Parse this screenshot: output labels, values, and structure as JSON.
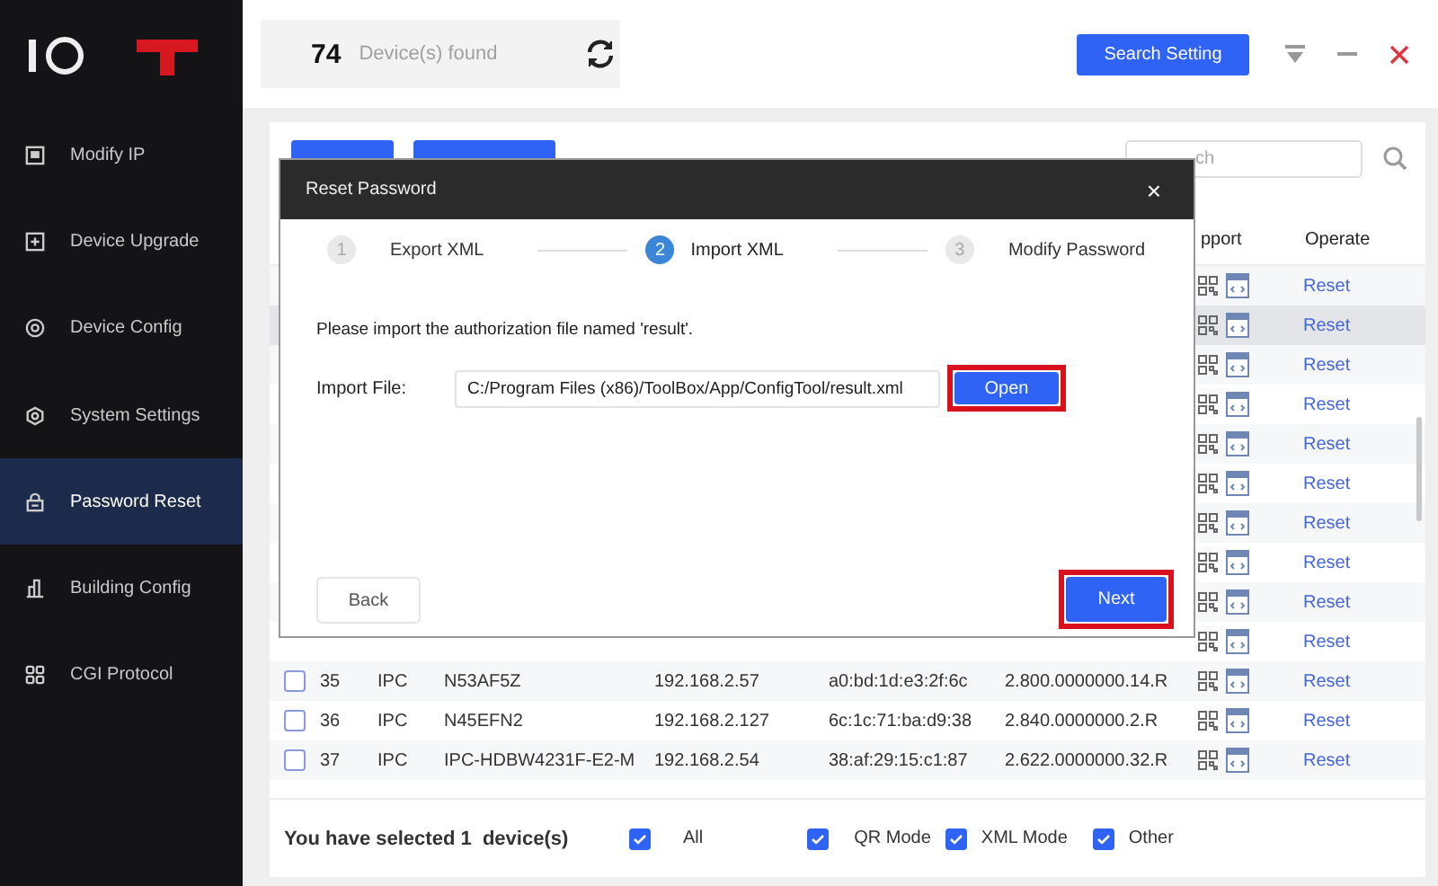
{
  "sidebar": {
    "items": [
      {
        "label": "Modify IP",
        "selected": false
      },
      {
        "label": "Device Upgrade",
        "selected": false
      },
      {
        "label": "Device Config",
        "selected": false
      },
      {
        "label": "System Settings",
        "selected": false
      },
      {
        "label": "Password Reset",
        "selected": true
      },
      {
        "label": "Building Config",
        "selected": false
      },
      {
        "label": "CGI Protocol",
        "selected": false
      }
    ]
  },
  "top_bar": {
    "count": "74",
    "count_label": "Device(s) found",
    "search_setting": "Search Setting"
  },
  "table": {
    "search_placeholder": "ch",
    "columns": [
      "pport",
      "Operate"
    ],
    "rows": [
      {
        "operate": "Reset",
        "selected": false
      },
      {
        "operate": "Reset",
        "selected": true
      },
      {
        "operate": "Reset",
        "selected": false
      },
      {
        "operate": "Reset",
        "selected": false
      },
      {
        "operate": "Reset",
        "selected": false
      },
      {
        "operate": "Reset",
        "selected": false
      },
      {
        "operate": "Reset",
        "selected": false
      },
      {
        "operate": "Reset",
        "selected": false
      },
      {
        "operate": "Reset",
        "selected": false
      },
      {
        "operate": "Reset",
        "selected": false
      },
      {
        "no": "35",
        "type": "IPC",
        "model": "N53AF5Z",
        "ip": "192.168.2.57",
        "mac": "a0:bd:1d:e3:2f:6c",
        "version": "2.800.0000000.14.R",
        "operate": "Reset",
        "selected": false,
        "checked": false
      },
      {
        "no": "36",
        "type": "IPC",
        "model": "N45EFN2",
        "ip": "192.168.2.127",
        "mac": "6c:1c:71:ba:d9:38",
        "version": "2.840.0000000.2.R",
        "operate": "Reset",
        "selected": false,
        "checked": false
      },
      {
        "no": "37",
        "type": "IPC",
        "model": "IPC-HDBW4231F-E2-M",
        "ip": "192.168.2.54",
        "mac": "38:af:29:15:c1:87",
        "version": "2.622.0000000.32.R",
        "operate": "Reset",
        "selected": false,
        "checked": false
      }
    ]
  },
  "footer": {
    "selected_text": "You have selected 1  device(s)",
    "filters": [
      {
        "label": "All",
        "checked": true
      },
      {
        "label": "QR Mode",
        "checked": true
      },
      {
        "label": "XML Mode",
        "checked": true
      },
      {
        "label": "Other",
        "checked": true
      }
    ]
  },
  "dialog": {
    "title": "Reset Password",
    "close": "×",
    "steps": [
      {
        "number": "1",
        "label": "Export XML",
        "selected": false
      },
      {
        "number": "2",
        "label": "Import XML",
        "selected": true
      },
      {
        "number": "3",
        "label": "Modify Password",
        "selected": false
      }
    ],
    "instruction": "Please import the authorization file named 'result'.",
    "file_label": "Import File:",
    "file_value": "C:/Program Files (x86)/ToolBox/App/ConfigTool/result.xml",
    "open": "Open",
    "back": "Back",
    "next": "Next"
  }
}
